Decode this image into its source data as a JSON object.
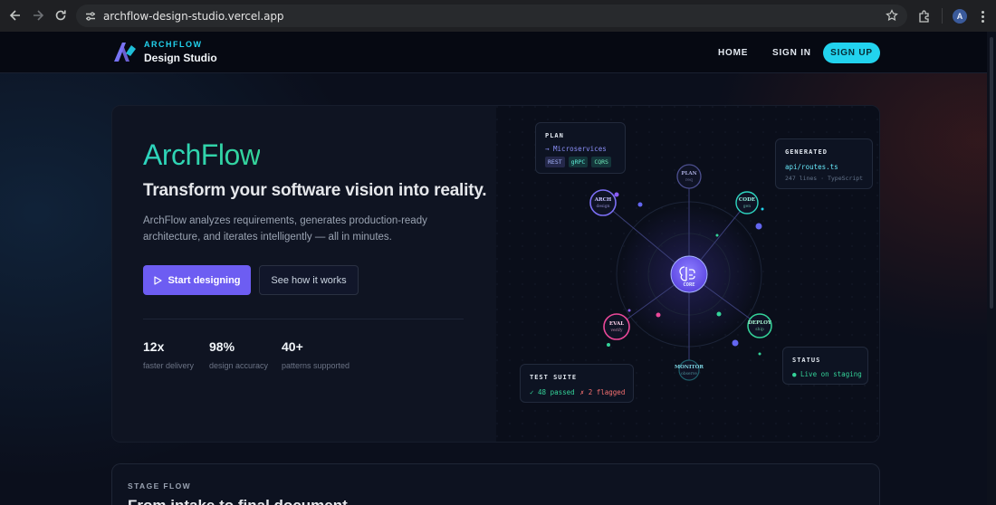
{
  "browser": {
    "url": "archflow-design-studio.vercel.app",
    "avatar_letter": "A"
  },
  "nav": {
    "brand_top": "ARCHFLOW",
    "brand_bottom": "Design Studio",
    "home": "HOME",
    "sign_in": "SIGN IN",
    "sign_up": "SIGN UP"
  },
  "hero": {
    "title": "ArchFlow",
    "subtitle": "Transform your software vision into reality.",
    "description": "ArchFlow analyzes requirements, generates production-ready architecture, and iterates intelligently — all in minutes.",
    "primary_button": "Start designing",
    "secondary_button": "See how it works",
    "stats": [
      {
        "value": "12x",
        "label": "faster delivery"
      },
      {
        "value": "98%",
        "label": "design accuracy"
      },
      {
        "value": "40+",
        "label": "patterns supported"
      }
    ]
  },
  "diagram": {
    "core_label": "CORE",
    "nodes": [
      {
        "title": "PLAN",
        "sub": "req"
      },
      {
        "title": "ARCH",
        "sub": "design"
      },
      {
        "title": "CODE",
        "sub": "gen"
      },
      {
        "title": "EVAL",
        "sub": "verify"
      },
      {
        "title": "DEPLOY",
        "sub": "ship"
      },
      {
        "title": "MONITOR",
        "sub": "observe"
      }
    ],
    "plan_card": {
      "title": "PLAN",
      "item": "→ Microservices",
      "tags": [
        "REST",
        "gRPC",
        "CQRS"
      ]
    },
    "generated_card": {
      "title": "GENERATED",
      "file": "api/routes.ts",
      "meta": "247 lines · TypeScript"
    },
    "test_card": {
      "title": "TEST SUITE",
      "passed": "✓ 48 passed",
      "flagged": "✗ 2 flagged"
    },
    "status_card": {
      "title": "STATUS",
      "text": "● Live on staging"
    }
  },
  "stage_flow": {
    "label": "STAGE FLOW",
    "title": "From intake to final document"
  },
  "colors": {
    "accent_cyan": "#22d3ee",
    "accent_teal": "#2dd4bf",
    "accent_purple": "#6d5df2",
    "background": "#0b0f1c"
  }
}
